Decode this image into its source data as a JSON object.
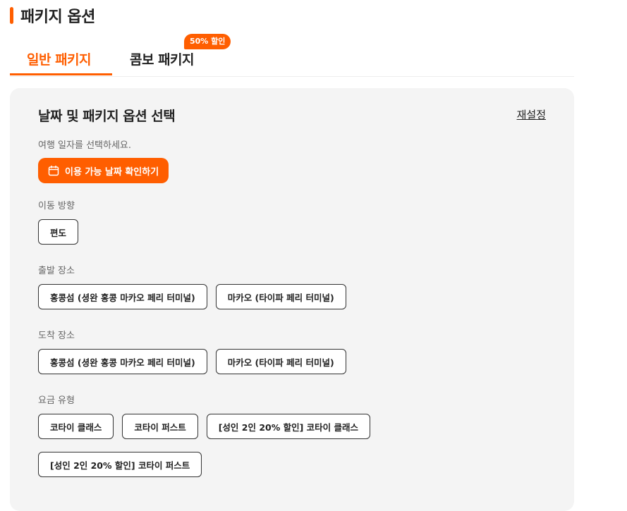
{
  "page": {
    "title": "패키지 옵션",
    "accent_color": "#ff5e00"
  },
  "tabs": {
    "general": "일반 패키지",
    "combo": "콤보 패키지",
    "combo_badge": "50% 할인"
  },
  "panel": {
    "title": "날짜 및 패키지 옵션 선택",
    "reset": "재설정",
    "instruction": "여행 일자를 선택하세요.",
    "date_button": "이용 가능 날짜 확인하기",
    "date_button_icon": "calendar-icon"
  },
  "sections": {
    "direction": {
      "label": "이동 방향",
      "options": [
        "편도"
      ]
    },
    "departure": {
      "label": "출발 장소",
      "options": [
        "홍콩섬 (셩완 홍콩 마카오 페리 터미널)",
        "마카오 (타이파 페리 터미널)"
      ]
    },
    "arrival": {
      "label": "도착 장소",
      "options": [
        "홍콩섬 (셩완 홍콩 마카오 페리 터미널)",
        "마카오 (타이파 페리 터미널)"
      ]
    },
    "fare": {
      "label": "요금 유형",
      "options": [
        "코타이 클래스",
        "코타이 퍼스트",
        "[성인 2인 20% 할인] 코타이 클래스",
        "[성인 2인 20% 할인] 코타이 퍼스트"
      ]
    }
  }
}
